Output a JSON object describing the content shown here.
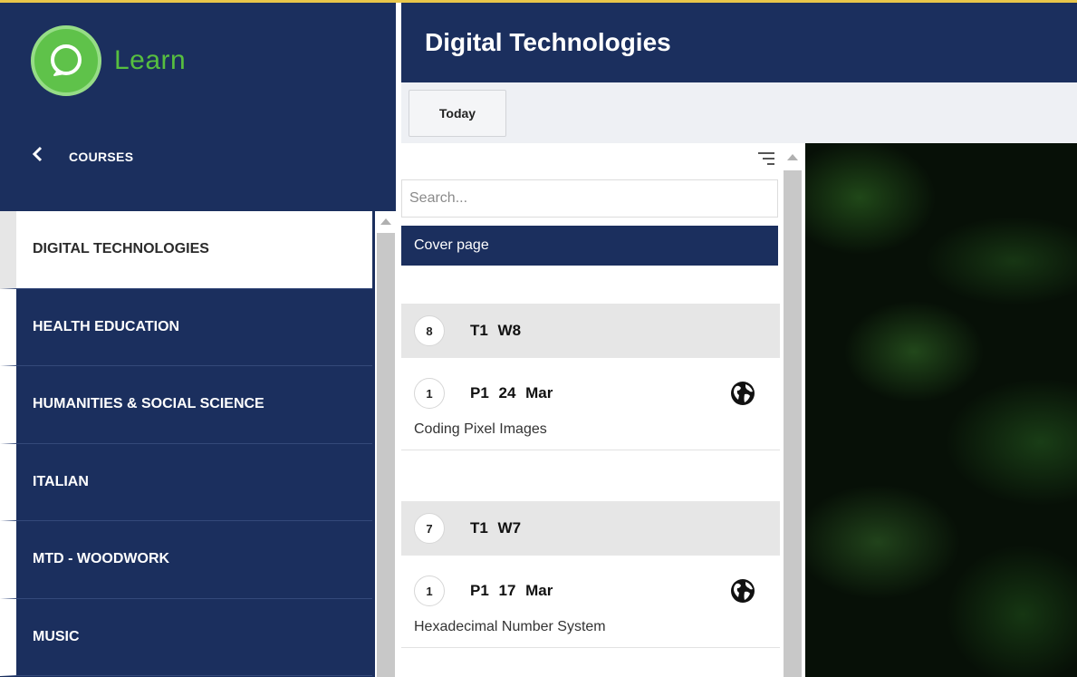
{
  "app": {
    "brand_name": "Learn",
    "accent_color": "#57bf3f",
    "nav_color": "#1b2f5e"
  },
  "sidebar": {
    "back_label": "COURSES",
    "back_icon": "chevron-left-icon",
    "courses": [
      {
        "label": "DIGITAL TECHNOLOGIES",
        "active": true
      },
      {
        "label": "HEALTH EDUCATION",
        "active": false
      },
      {
        "label": "HUMANITIES & SOCIAL SCIENCE",
        "active": false
      },
      {
        "label": "ITALIAN",
        "active": false
      },
      {
        "label": "MTD - WOODWORK",
        "active": false
      },
      {
        "label": "MUSIC",
        "active": false
      }
    ]
  },
  "header": {
    "title": "Digital Technologies"
  },
  "toolbar": {
    "today_label": "Today"
  },
  "lessons_panel": {
    "sort_icon": "sort-icon",
    "search_placeholder": "Search...",
    "cover_label": "Cover page",
    "weeks": [
      {
        "number": "8",
        "label": "T1  W8",
        "lessons": [
          {
            "number": "1",
            "label": "P1  24 Mar",
            "title": "Coding Pixel Images",
            "icon": "globe-icon"
          }
        ]
      },
      {
        "number": "7",
        "label": "T1  W7",
        "lessons": [
          {
            "number": "1",
            "label": "P1  17 Mar",
            "title": "Hexadecimal Number System",
            "icon": "globe-icon"
          }
        ]
      }
    ]
  }
}
